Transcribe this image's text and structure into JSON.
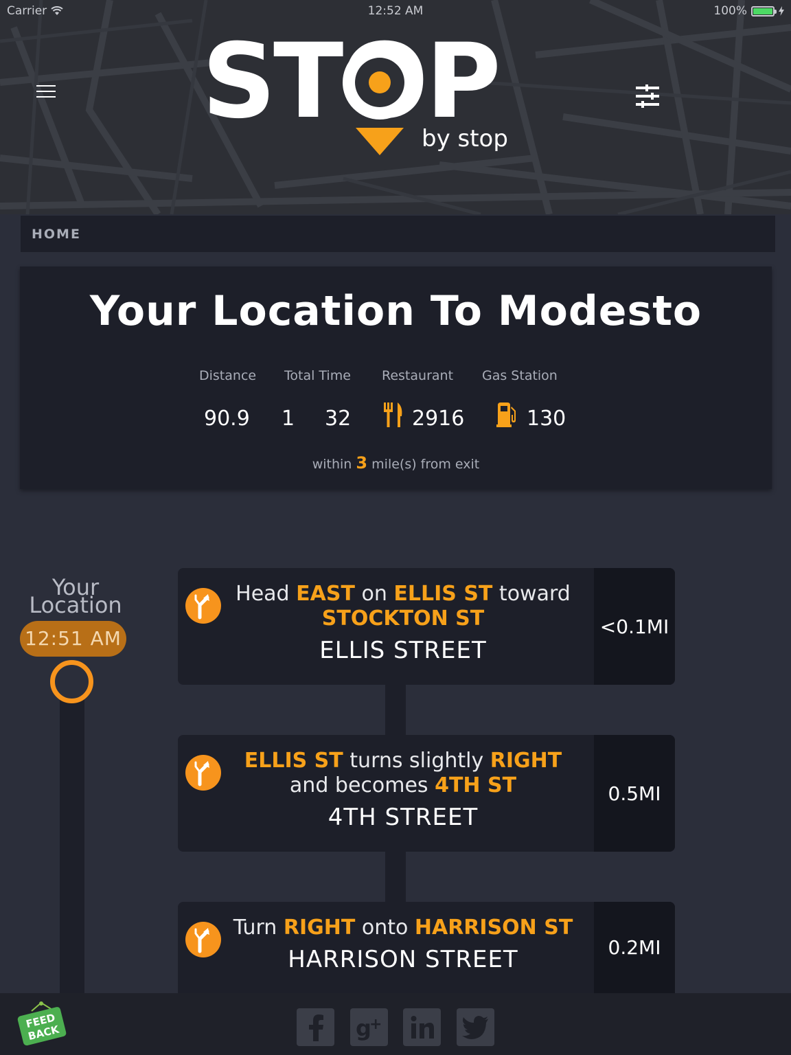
{
  "status_bar": {
    "carrier": "Carrier",
    "time": "12:52 AM",
    "battery": "100%"
  },
  "logo": {
    "word": "STOP",
    "sub": "by stop",
    "accent": "#f7a11a"
  },
  "breadcrumb": {
    "label": "HOME"
  },
  "summary": {
    "title": "Your Location To Modesto",
    "labels": {
      "distance": "Distance",
      "total_time": "Total Time",
      "restaurant": "Restaurant",
      "gas_station": "Gas Station"
    },
    "values": {
      "distance": "90.9",
      "hours": "1",
      "minutes": "32",
      "restaurants": "2916",
      "gas_stations": "130"
    },
    "within_prefix": "within",
    "within_miles": "3",
    "within_suffix": "mile(s) from exit"
  },
  "timeline": {
    "start_label_line1": "Your",
    "start_label_line2": "Location",
    "start_time": "12:51 AM"
  },
  "steps": [
    {
      "parts": [
        "Head ",
        "EAST",
        " on ",
        "ELLIS ST",
        " toward ",
        "STOCKTON ST"
      ],
      "street": "ELLIS STREET",
      "distance": "<0.1MI"
    },
    {
      "parts": [
        "ELLIS ST",
        " turns slightly ",
        "RIGHT",
        "and becomes ",
        "4TH ST"
      ],
      "street": "4TH STREET",
      "distance": "0.5MI"
    },
    {
      "parts": [
        "Turn ",
        "RIGHT",
        " onto ",
        "HARRISON ST"
      ],
      "street": "HARRISON STREET",
      "distance": "0.2MI"
    }
  ],
  "footer": {
    "feedback_line1": "FEED",
    "feedback_line2": "BACK"
  },
  "icons": [
    "wifi-icon",
    "battery-icon",
    "hamburger-menu-icon",
    "filter-sliders-icon",
    "map-pin-icon",
    "fork-knife-icon",
    "gas-pump-icon",
    "turn-slight-right-icon",
    "facebook-icon",
    "google-plus-icon",
    "linkedin-icon",
    "twitter-icon",
    "feedback-sign-icon"
  ]
}
